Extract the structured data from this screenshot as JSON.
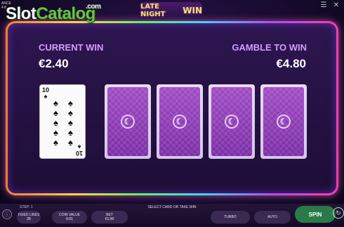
{
  "top_info": {
    "line1": "ANCE",
    "line2": "4.8"
  },
  "watermark": {
    "slot": "Slot",
    "catalog": "Catalog",
    "com": ".com"
  },
  "logo": {
    "line1": "LATE NIGHT",
    "line2": "WIN"
  },
  "icons": {
    "menu": "☰",
    "close": "✕"
  },
  "gamble": {
    "current_label": "CURRENT WIN",
    "current_value": "€2.40",
    "gamble_label": "GAMBLE TO WIN",
    "gamble_value": "€4.80"
  },
  "revealed_card": {
    "rank": "10",
    "suit": "♠",
    "pips": [
      "♠",
      "♠",
      "♠",
      "♠",
      "♠",
      "♠",
      "♠",
      "♠",
      "♠",
      "♠"
    ]
  },
  "hidden_card_emblem": "☾",
  "bottom": {
    "step": "STEP: 1",
    "status": "SELECT CARD OR TAKE WIN",
    "fixed_lines_label": "FIXED LINES",
    "fixed_lines_value": "25",
    "coin_value_label": "COIN VALUE",
    "coin_value_value": "0.01",
    "bet_label": "BET",
    "bet_value": "€1.00",
    "turbo": "TURBO",
    "auto": "AUTO",
    "spin": "SPIN",
    "info_icon": "ⓘ",
    "spin_icon": "↻"
  },
  "colors": {
    "label": "#d59bff",
    "spin": "#2a7a47",
    "card_back": "#8a3cb6"
  }
}
